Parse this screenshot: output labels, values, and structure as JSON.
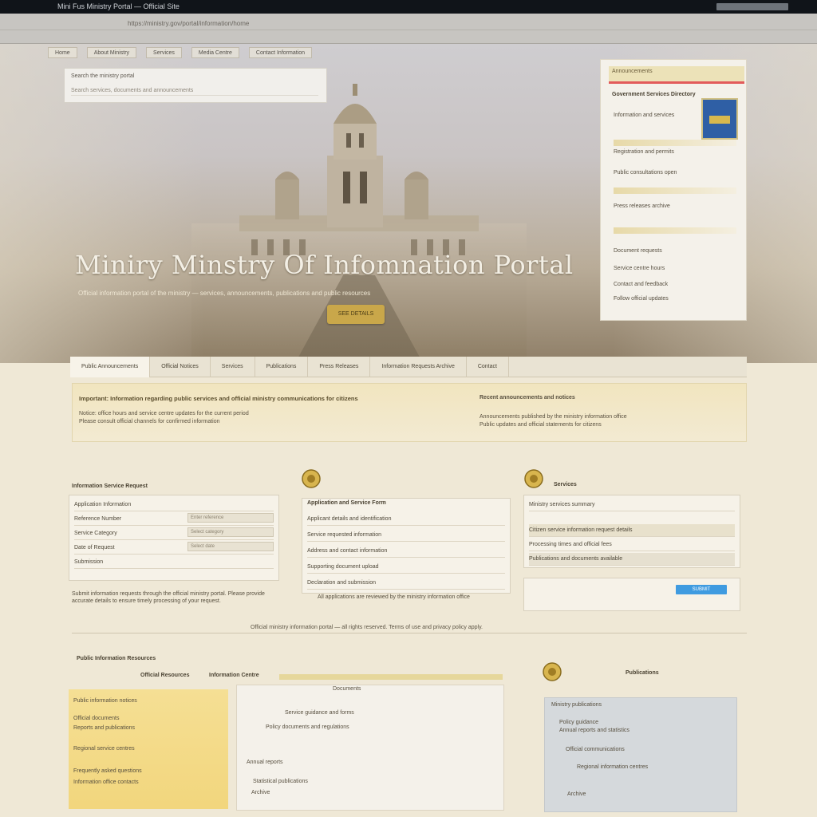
{
  "window": {
    "title": "Mini Fus Ministry Portal — Official Site"
  },
  "browser": {
    "url": "https://ministry.gov/portal/information/home"
  },
  "hero": {
    "nav": [
      "Home",
      "About Ministry",
      "Services",
      "Media Centre",
      "Contact Information"
    ],
    "search_label": "Search the ministry portal",
    "search_placeholder": "Search services, documents and announcements",
    "title": "Miniry Minstry  Of  Infomnation Portal",
    "subtitle": "Official information portal of the ministry — services, announcements, publications and public resources",
    "cta": "SEE DETAILS"
  },
  "right_panel": {
    "header": "Announcements",
    "title": "Government Services Directory",
    "lines": [
      "Information and services",
      "Registration and permits",
      "Public consultations open",
      "Press releases archive",
      "Document requests",
      "Service centre hours",
      "Contact and feedback",
      "Follow official updates"
    ]
  },
  "mainnav": {
    "tabs": [
      "Public Announcements",
      "Official Notices",
      "Services",
      "Publications",
      "Press Releases",
      "Information Requests Archive",
      "Contact"
    ]
  },
  "notice": {
    "heading": "Important: Information regarding public services and official ministry communications for citizens",
    "lines": [
      "Notice: office hours and service centre updates for the current period",
      "Please consult official channels for confirmed information"
    ],
    "right_heading": "Recent announcements and notices",
    "right_lines": [
      "Announcements published by the ministry information office",
      "Public updates and official statements for citizens"
    ]
  },
  "col1": {
    "title": "Information Service Request",
    "rows": [
      "Application Information",
      "Reference Number",
      "Service Category",
      "Date of Request",
      "Submission"
    ],
    "fields": [
      "Enter reference",
      "Select category",
      "Select date"
    ],
    "para": "Submit information requests through the official ministry portal. Please provide accurate details to ensure timely processing of your request."
  },
  "col2": {
    "title": "Application and Service Form",
    "rows": [
      "Applicant details and identification",
      "Service requested information",
      "Address and contact information",
      "Supporting document upload",
      "Declaration and submission"
    ],
    "para": "All applications are reviewed by the ministry information office"
  },
  "col3": {
    "title": "Services",
    "rows": [
      "Ministry services summary",
      "Citizen service information request details",
      "Processing times and official fees",
      "Publications and documents available"
    ],
    "button": "SUBMIT"
  },
  "footnote": "Official ministry information portal — all rights reserved. Terms of use and privacy policy apply.",
  "bottom": {
    "section_title": "Public Information Resources",
    "tab_labels": [
      "Official Resources",
      "Information Centre"
    ],
    "right_title": "Publications",
    "yellow_lines": [
      "Public information notices",
      "Official documents",
      "Reports and publications",
      "Regional service centres",
      "Frequently asked questions",
      "Information office contacts"
    ],
    "middle_lines": [
      "Documents",
      "Service guidance and forms",
      "Policy documents and regulations",
      "Annual reports",
      "Statistical publications",
      "Archive"
    ],
    "blue_lines": [
      "Ministry publications",
      "Policy guidance",
      "Annual reports and statistics",
      "Official communications",
      "Regional information centres",
      "Archive"
    ]
  }
}
